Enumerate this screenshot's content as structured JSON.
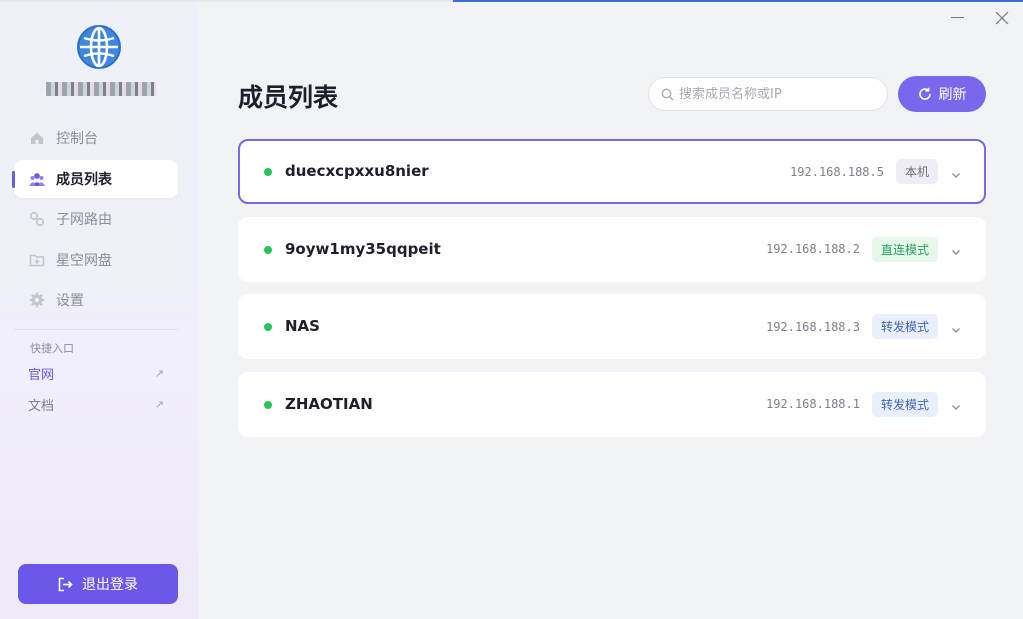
{
  "colors": {
    "accent": "#6b57e8",
    "online": "#27c35b",
    "direct_mode": "#27a35a",
    "relay_mode": "#3f64b8"
  },
  "sidebar": {
    "logo_icon": "globe-icon",
    "nav": [
      {
        "label": "控制台",
        "icon": "home-icon"
      },
      {
        "label": "成员列表",
        "icon": "members-icon"
      },
      {
        "label": "子网路由",
        "icon": "subnet-route-icon"
      },
      {
        "label": "星空网盘",
        "icon": "cloud-drive-icon"
      },
      {
        "label": "设置",
        "icon": "gear-icon"
      }
    ],
    "quick_title": "快捷入口",
    "quick_links": [
      {
        "label": "官网",
        "icon": "external-link-icon"
      },
      {
        "label": "文档",
        "icon": "external-link-icon"
      }
    ],
    "logout_label": "退出登录"
  },
  "header": {
    "title": "成员列表",
    "search_placeholder": "搜索成员名称或IP",
    "refresh_label": "刷新"
  },
  "members": [
    {
      "name": "duecxcpxxu8nier",
      "ip": "192.168.188.5",
      "badge": "本机",
      "status": "online"
    },
    {
      "name": "9oyw1my35qqpeit",
      "ip": "192.168.188.2",
      "badge": "直连模式",
      "status": "online"
    },
    {
      "name": "NAS",
      "ip": "192.168.188.3",
      "badge": "转发模式",
      "status": "online"
    },
    {
      "name": "ZHAOTIAN",
      "ip": "192.168.188.1",
      "badge": "转发模式",
      "status": "online"
    }
  ]
}
